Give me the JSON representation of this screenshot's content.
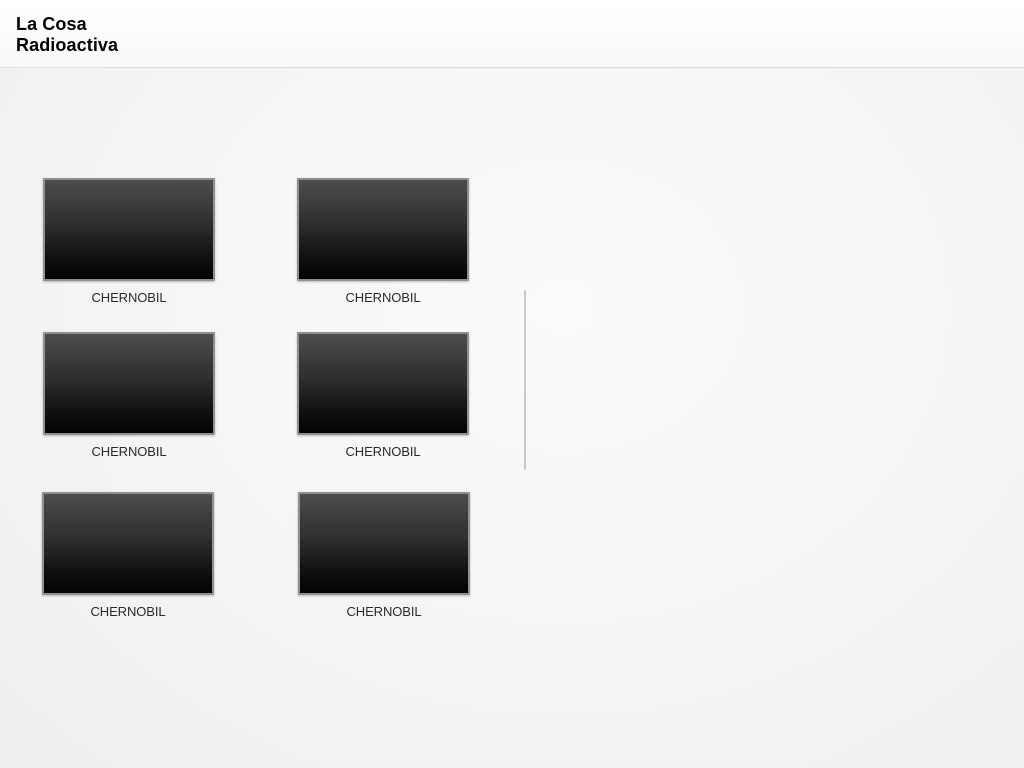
{
  "header": {
    "title": "La Cosa Radioactiva"
  },
  "gallery": {
    "items": [
      {
        "label": "CHERNOBIL"
      },
      {
        "label": "CHERNOBIL"
      },
      {
        "label": "CHERNOBIL"
      },
      {
        "label": "CHERNOBIL"
      },
      {
        "label": "CHERNOBIL"
      },
      {
        "label": "CHERNOBIL"
      }
    ]
  },
  "colors": {
    "thumbnail_top": "#4d4d4d",
    "thumbnail_bottom": "#030303",
    "thumbnail_border": "#8f8f8f",
    "caption_text": "#2a2a2a",
    "header_background": "#ffffff"
  }
}
